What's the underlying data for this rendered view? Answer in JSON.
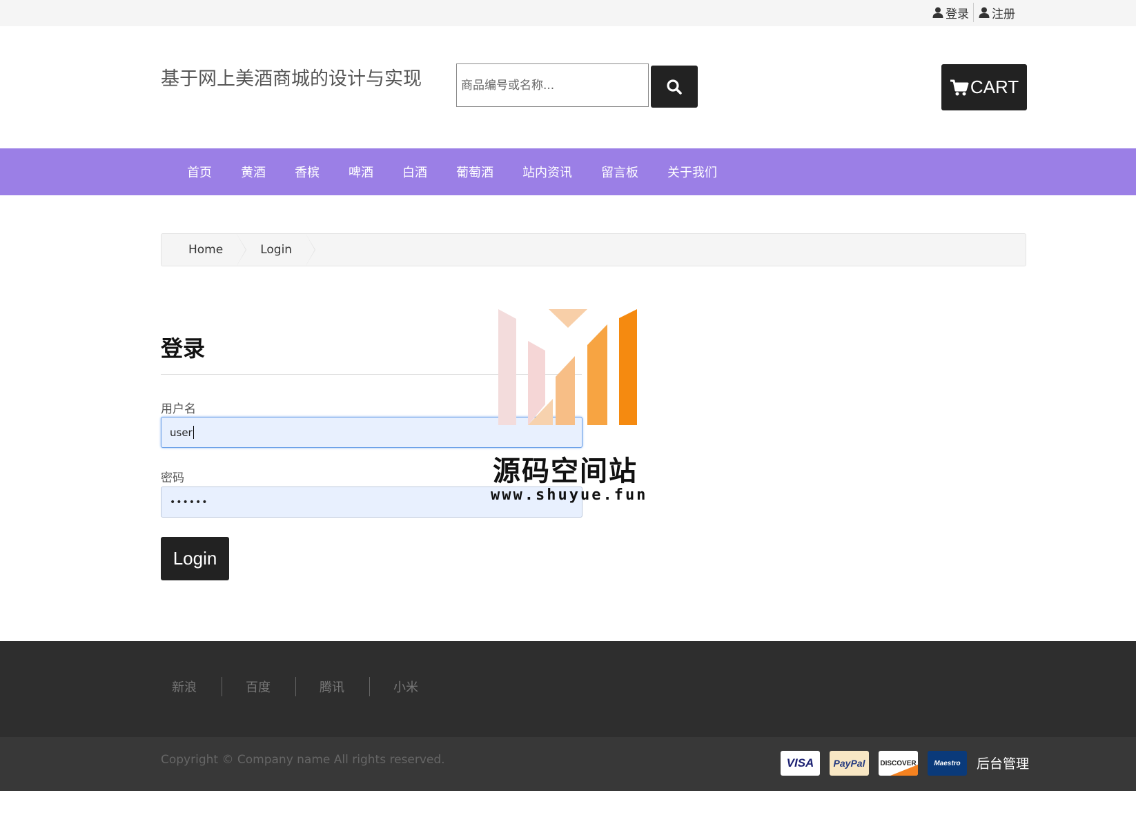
{
  "topbar": {
    "login_label": "登录",
    "register_label": "注册"
  },
  "header": {
    "site_title": "基于网上美酒商城的设计与实现",
    "search_placeholder": "商品编号或名称...",
    "cart_label": "CART"
  },
  "nav": {
    "items": [
      "首页",
      "黄酒",
      "香槟",
      "啤酒",
      "白酒",
      "葡萄酒",
      "站内资讯",
      "留言板",
      "关于我们"
    ]
  },
  "breadcrumb": {
    "items": [
      "Home",
      "Login"
    ]
  },
  "login_form": {
    "heading": "登录",
    "username_label": "用户名",
    "username_value": "user",
    "password_label": "密码",
    "password_value": "••••••",
    "submit_label": "Login"
  },
  "watermark": {
    "name": "源码空间站",
    "url": "www.shuyue.fun"
  },
  "footer": {
    "links": [
      "新浪",
      "百度",
      "腾讯",
      "小米"
    ],
    "copyright": "Copyright © Company name All rights reserved.",
    "payments": [
      "VISA",
      "PayPal",
      "DISCOVER",
      "Maestro"
    ],
    "admin_label": "后台管理"
  },
  "colors": {
    "nav_bg": "#9b7fe6",
    "button_bg": "#222222",
    "footer_top_bg": "#2e2e2e",
    "footer_bottom_bg": "#383838",
    "input_bg": "#e8f0fe"
  }
}
